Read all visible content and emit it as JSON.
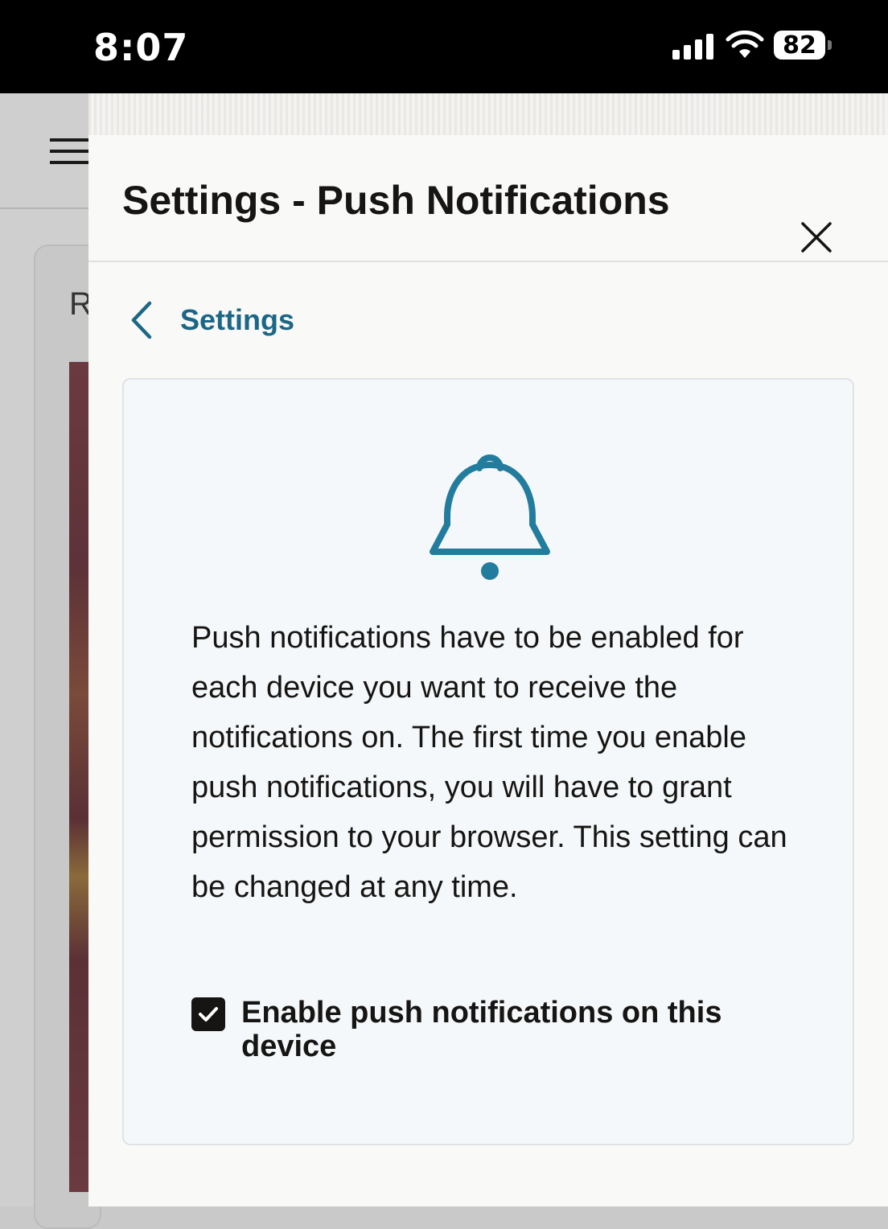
{
  "status_bar": {
    "time": "8:07",
    "battery_level": "82",
    "icons": [
      "signal-icon",
      "wifi-icon",
      "battery-icon"
    ]
  },
  "background_app": {
    "partial_text": "R",
    "icons": [
      "hamburger-menu-icon"
    ]
  },
  "panel": {
    "title": "Settings - Push Notifications",
    "close_icon": "close-icon",
    "back": {
      "icon": "chevron-left-icon",
      "label": "Settings"
    },
    "card": {
      "icon": "bell-icon",
      "description": "Push notifications have to be enabled for each device you want to receive the notifications on. The first time you enable push notifications, you will have to grant permission to your browser. This setting can be changed at any time.",
      "checkbox": {
        "label": "Enable push notifications on this device",
        "checked": true
      }
    }
  },
  "colors": {
    "accent": "#1c6686",
    "bell": "#227c9d",
    "text": "#161513",
    "panel_bg": "#f9f9f8",
    "card_bg": "#f5f8fa"
  }
}
